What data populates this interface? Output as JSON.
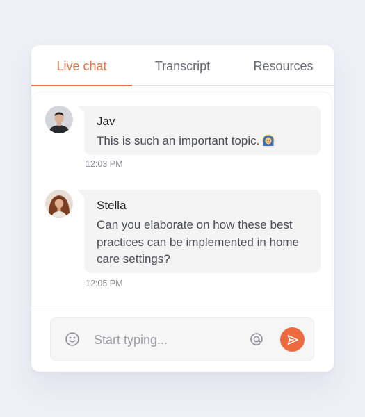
{
  "tabs": {
    "live_chat": "Live chat",
    "transcript": "Transcript",
    "resources": "Resources",
    "active": "live_chat"
  },
  "messages": [
    {
      "sender": "Jav",
      "text": "This is such an important topic.",
      "emoji_icon": "person-with-headscarf-emoji",
      "time": "12:03 PM"
    },
    {
      "sender": "Stella",
      "text": "Can you elaborate on how these best practices can be implemented in home care settings?",
      "time": "12:05 PM"
    }
  ],
  "composer": {
    "placeholder": "Start typing...",
    "emoji_icon": "smiley-icon",
    "mention_icon": "at-sign-icon",
    "send_icon": "send-icon"
  },
  "colors": {
    "accent": "#e8703f",
    "send_button": "#ec6a3f",
    "page_background": "#eef0f7",
    "bubble_background": "#f4f4f5"
  }
}
